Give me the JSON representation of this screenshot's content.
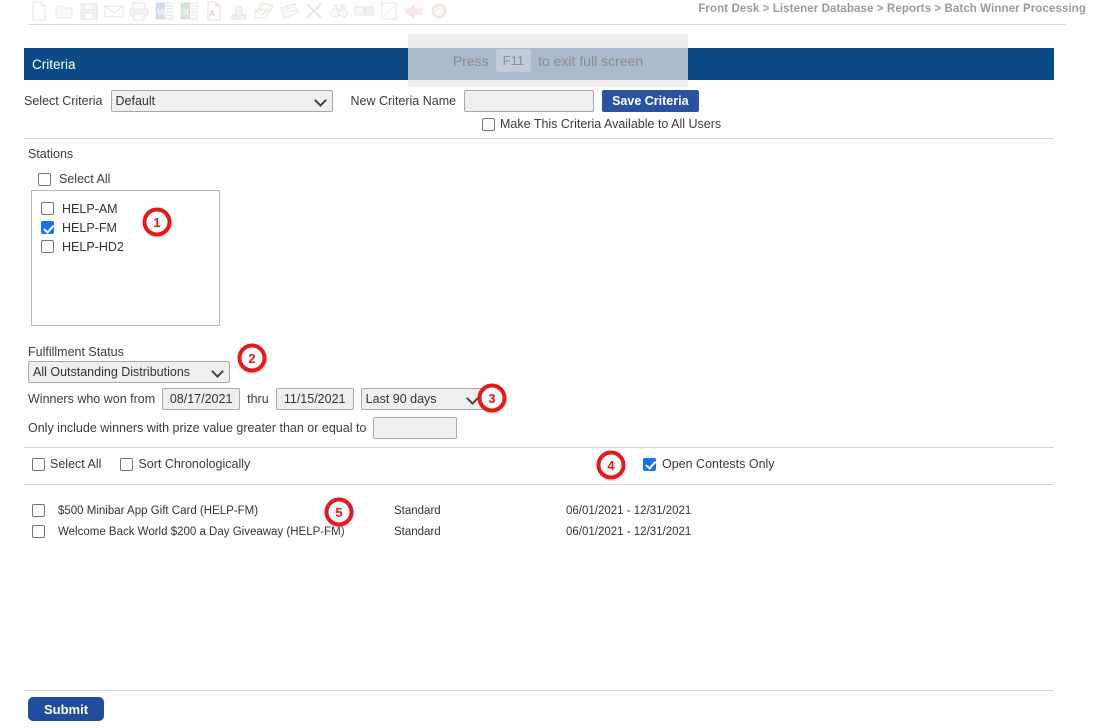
{
  "breadcrumb": "Front Desk > Listener Database > Reports > Batch Winner Processing",
  "overlay": {
    "press_label": "Press",
    "key_label": "F11",
    "suffix_label": "to exit full screen"
  },
  "criteria_panel": {
    "title": "Criteria",
    "select_criteria_label": "Select Criteria",
    "select_criteria_value": "Default",
    "new_criteria_name_label": "New Criteria Name",
    "new_criteria_name_value": "",
    "save_button_label": "Save Criteria",
    "make_available_label": "Make This Criteria Available to All Users",
    "make_available_checked": false
  },
  "stations": {
    "label": "Stations",
    "select_all_label": "Select All",
    "select_all_checked": false,
    "items": [
      {
        "label": "HELP-AM",
        "checked": false
      },
      {
        "label": "HELP-FM",
        "checked": true
      },
      {
        "label": "HELP-HD2",
        "checked": false
      }
    ]
  },
  "fulfillment": {
    "label": "Fulfillment Status",
    "status_value": "All Outstanding Distributions",
    "winners_from_label": "Winners who won from",
    "date_from": "08/17/2021",
    "thru_label": "thru",
    "date_thru": "11/15/2021",
    "range_preset": "Last 90 days",
    "prize_label": "Only include winners with prize value greater than or equal to",
    "prize_value": ""
  },
  "contests": {
    "select_all_label": "Select All",
    "select_all_checked": false,
    "sort_chronologically_label": "Sort Chronologically",
    "sort_chronologically_checked": false,
    "open_contests_only_label": "Open Contests Only",
    "open_contests_only_checked": true,
    "rows": [
      {
        "name": "$500 Minibar App Gift Card (HELP-FM)",
        "type": "Standard",
        "dates": "06/01/2021 - 12/31/2021",
        "checked": false
      },
      {
        "name": "Welcome Back World $200 a Day Giveaway (HELP-FM)",
        "type": "Standard",
        "dates": "06/01/2021 - 12/31/2021",
        "checked": false
      }
    ]
  },
  "footer": {
    "submit_label": "Submit"
  },
  "annotations": [
    {
      "number": "1"
    },
    {
      "number": "2"
    },
    {
      "number": "3"
    },
    {
      "number": "4"
    },
    {
      "number": "5"
    }
  ],
  "colors": {
    "header_blue": "#0b4a85",
    "button_blue": "#2a52a0",
    "submit_blue": "#1f4e9c",
    "checkbox_blue": "#1a73e8",
    "annotation_red": "#e01b1b",
    "breadcrumb_gray": "#9a9a9a"
  },
  "toolbar_icons": [
    "new-document-icon",
    "folder-icon",
    "save-floppy-icon",
    "envelope-icon",
    "printer-icon",
    "word-export-icon",
    "excel-export-icon",
    "pdf-export-icon",
    "stamp-icon",
    "mail-merge-icon",
    "letter-icon",
    "close-x-icon",
    "binoculars-icon",
    "badge-icon",
    "notepad-icon",
    "back-arrow-icon",
    "gear-icon"
  ]
}
